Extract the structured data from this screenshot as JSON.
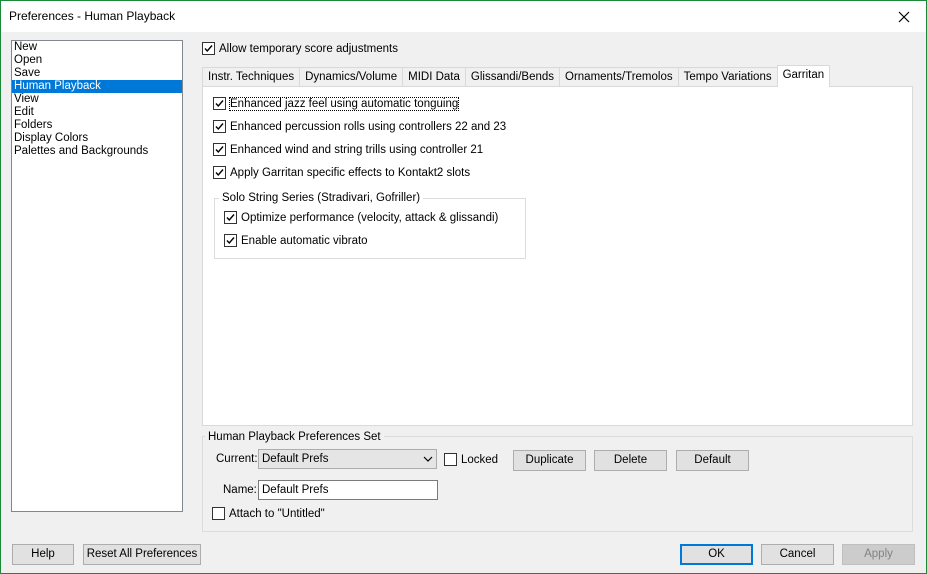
{
  "window": {
    "title": "Preferences - Human Playback"
  },
  "sidebar": {
    "items": [
      {
        "label": "New",
        "selected": false
      },
      {
        "label": "Open",
        "selected": false
      },
      {
        "label": "Save",
        "selected": false
      },
      {
        "label": "Human Playback",
        "selected": true
      },
      {
        "label": "View",
        "selected": false
      },
      {
        "label": "Edit",
        "selected": false
      },
      {
        "label": "Folders",
        "selected": false
      },
      {
        "label": "Display Colors",
        "selected": false
      },
      {
        "label": "Palettes and Backgrounds",
        "selected": false
      }
    ]
  },
  "allow_temp": {
    "label": "Allow temporary score adjustments",
    "checked": true
  },
  "tabs": [
    {
      "label": "Instr. Techniques",
      "active": false
    },
    {
      "label": "Dynamics/Volume",
      "active": false
    },
    {
      "label": "MIDI Data",
      "active": false
    },
    {
      "label": "Glissandi/Bends",
      "active": false
    },
    {
      "label": "Ornaments/Tremolos",
      "active": false
    },
    {
      "label": "Tempo Variations",
      "active": false
    },
    {
      "label": "Garritan",
      "active": true
    }
  ],
  "garritan": {
    "options": [
      {
        "label": "Enhanced jazz feel using automatic tonguing",
        "checked": true
      },
      {
        "label": "Enhanced percussion rolls using controllers 22 and 23",
        "checked": true
      },
      {
        "label": "Enhanced wind and string trills using controller 21",
        "checked": true
      },
      {
        "label": "Apply Garritan specific effects to Kontakt2 slots",
        "checked": true
      }
    ],
    "solo_group": {
      "title": "Solo String Series (Stradivari, Gofriller)",
      "options": [
        {
          "label": "Optimize performance (velocity, attack & glissandi)",
          "checked": true
        },
        {
          "label": "Enable automatic vibrato",
          "checked": true
        }
      ]
    }
  },
  "prefs_set": {
    "title": "Human Playback Preferences Set",
    "current_label": "Current:",
    "current_value": "Default Prefs",
    "locked": {
      "label": "Locked",
      "checked": false
    },
    "duplicate_label": "Duplicate",
    "delete_label": "Delete",
    "default_label": "Default",
    "name_label": "Name:",
    "name_value": "Default Prefs",
    "attach": {
      "label": "Attach to \"Untitled\"",
      "checked": false
    }
  },
  "footer": {
    "help_label": "Help",
    "reset_label": "Reset All Preferences",
    "ok_label": "OK",
    "cancel_label": "Cancel",
    "apply_label": "Apply"
  },
  "icons": {
    "close": "close-icon",
    "check": "checkmark-icon",
    "dropdown": "chevron-down-icon"
  },
  "colors": {
    "selection": "#0078d7",
    "border_accent": "#1a8a38"
  }
}
